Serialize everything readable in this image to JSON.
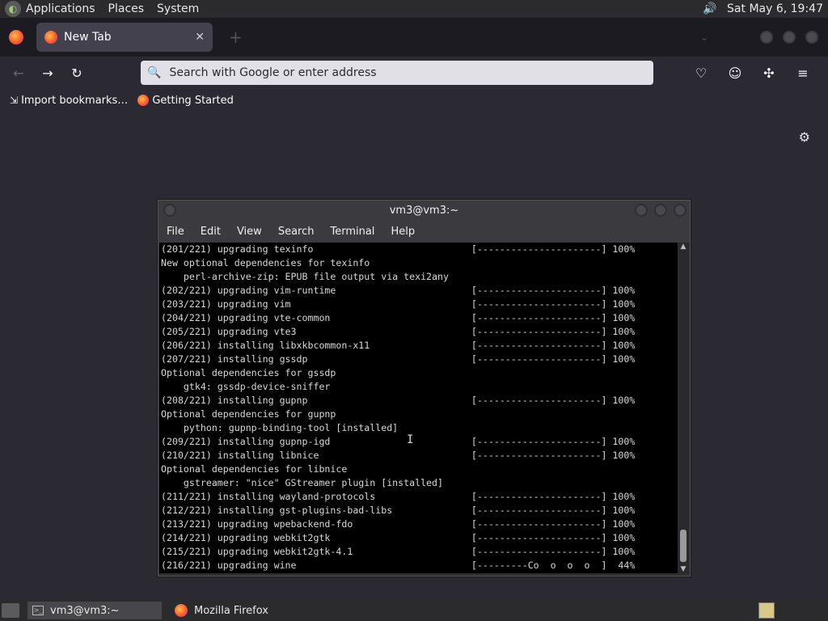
{
  "topbar": {
    "menus": [
      "Applications",
      "Places",
      "System"
    ],
    "clock": "Sat May  6, 19:47"
  },
  "browser": {
    "tab_title": "New Tab",
    "tab_close": "✕",
    "new_tab": "+",
    "url_placeholder": "Search with Google or enter address",
    "bookmarks": [
      "Import bookmarks…",
      "Getting Started"
    ]
  },
  "terminal": {
    "title": "vm3@vm3:~",
    "menu": [
      "File",
      "Edit",
      "View",
      "Search",
      "Terminal",
      "Help"
    ],
    "lines": [
      "(201/221) upgrading texinfo                            [----------------------] 100%",
      "New optional dependencies for texinfo",
      "    perl-archive-zip: EPUB file output via texi2any",
      "(202/221) upgrading vim-runtime                        [----------------------] 100%",
      "(203/221) upgrading vim                                [----------------------] 100%",
      "(204/221) upgrading vte-common                         [----------------------] 100%",
      "(205/221) upgrading vte3                               [----------------------] 100%",
      "(206/221) installing libxkbcommon-x11                  [----------------------] 100%",
      "(207/221) installing gssdp                             [----------------------] 100%",
      "Optional dependencies for gssdp",
      "    gtk4: gssdp-device-sniffer",
      "(208/221) installing gupnp                             [----------------------] 100%",
      "Optional dependencies for gupnp",
      "    python: gupnp-binding-tool [installed]",
      "(209/221) installing gupnp-igd                         [----------------------] 100%",
      "(210/221) installing libnice                           [----------------------] 100%",
      "Optional dependencies for libnice",
      "    gstreamer: \"nice\" GStreamer plugin [installed]",
      "(211/221) installing wayland-protocols                 [----------------------] 100%",
      "(212/221) installing gst-plugins-bad-libs              [----------------------] 100%",
      "(213/221) upgrading wpebackend-fdo                     [----------------------] 100%",
      "(214/221) upgrading webkit2gtk                         [----------------------] 100%",
      "(215/221) upgrading webkit2gtk-4.1                     [----------------------] 100%",
      "(216/221) upgrading wine                               [---------Co  o  o  o  ]  44%"
    ]
  },
  "taskbar": {
    "tasks": [
      "vm3@vm3:~",
      "Mozilla Firefox"
    ]
  },
  "colors": {
    "desktop_bg": "#3d3d42",
    "browser_bg": "#2b2a33",
    "terminal_bg": "#000000",
    "terminal_fg": "#d8d8d8"
  }
}
